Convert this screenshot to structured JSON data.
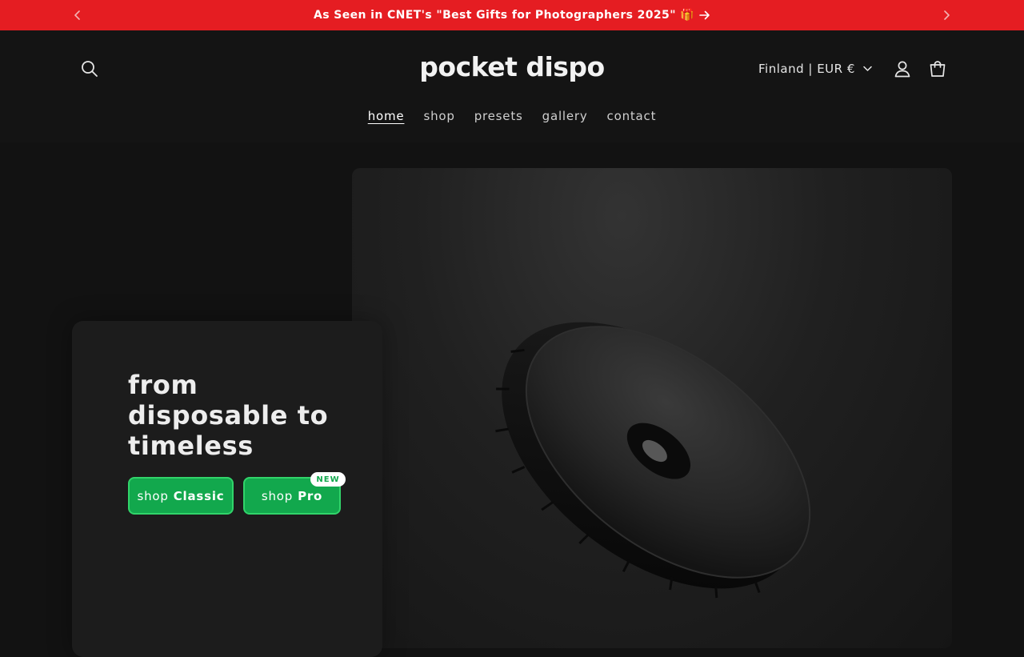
{
  "announcement": {
    "text": "As Seen in CNET's \"Best Gifts for Photographers 2025\" 🎁",
    "prev_icon": "chevron-left-icon",
    "next_icon": "chevron-right-icon",
    "link_icon": "arrow-right-icon"
  },
  "header": {
    "logo": "pocket dispo",
    "locale": "Finland | EUR €",
    "icons": [
      "search-icon",
      "user-icon",
      "shopping-bag-icon",
      "chevron-down-icon"
    ]
  },
  "nav": {
    "items": [
      {
        "label": "home",
        "active": true
      },
      {
        "label": "shop",
        "active": false
      },
      {
        "label": "presets",
        "active": false
      },
      {
        "label": "gallery",
        "active": false
      },
      {
        "label": "contact",
        "active": false
      }
    ]
  },
  "hero": {
    "heading": "from disposable to timeless",
    "buttons": {
      "classic_prefix": "shop",
      "classic_strong": "Classic",
      "pro_prefix": "shop",
      "pro_strong": "Pro"
    },
    "badge": "NEW",
    "image_subject": "black textured lens-cap product on dark background"
  },
  "colors": {
    "announcement_bg": "#e51d22",
    "page_bg": "#121212",
    "accent_green": "#12a84d",
    "accent_green_border": "#31d46a"
  }
}
